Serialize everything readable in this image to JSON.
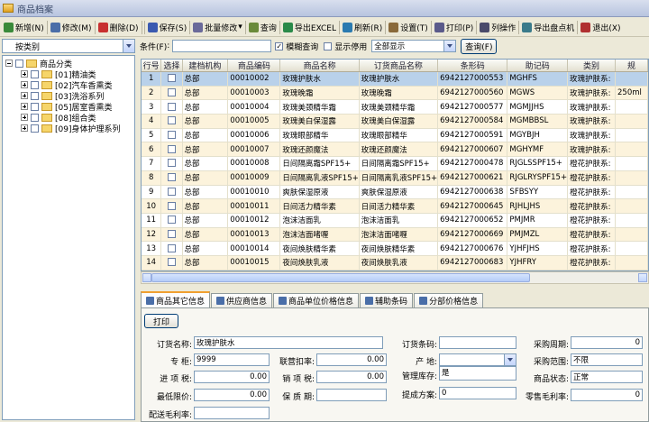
{
  "window": {
    "title": "商品档案"
  },
  "toolbar": [
    {
      "name": "add-button",
      "label": "新增(N)",
      "color": "#3a8a3a"
    },
    {
      "name": "edit-button",
      "label": "修改(M)",
      "color": "#4a6ea8"
    },
    {
      "name": "delete-button",
      "label": "删除(D)",
      "color": "#c83030"
    },
    {
      "name": "sep"
    },
    {
      "name": "save-button",
      "label": "保存(S)",
      "color": "#3a5ab0"
    },
    {
      "name": "batch-edit-button",
      "label": "批量修改",
      "color": "#6a6a9a",
      "dropdown": true
    },
    {
      "name": "query-button",
      "label": "查询",
      "color": "#6a8a3a"
    },
    {
      "name": "export-excel-button",
      "label": "导出EXCEL",
      "color": "#2a8a4a"
    },
    {
      "name": "refresh-button",
      "label": "刷新(R)",
      "color": "#2a7ab0"
    },
    {
      "name": "settings-button",
      "label": "设置(T)",
      "color": "#8a6a3a"
    },
    {
      "name": "print-button",
      "label": "打印(P)",
      "color": "#5a5a8a"
    },
    {
      "name": "columns-button",
      "label": "列操作",
      "color": "#4a4a6a"
    },
    {
      "name": "export-inventory-button",
      "label": "导出盘点机",
      "color": "#3a7a8a"
    },
    {
      "name": "exit-button",
      "label": "退出(X)",
      "color": "#b03030"
    }
  ],
  "left": {
    "combo_value": "按类别",
    "tree_root": "商品分类",
    "tree_items": [
      "[01]精油类",
      "[02]汽车香熏类",
      "[03]洗浴系列",
      "[05]居室香熏类",
      "[08]组合类",
      "[09]身体护理系列"
    ]
  },
  "filter": {
    "condition_label": "条件(F)",
    "condition_value": "",
    "fuzzy_label": "模糊查询",
    "fuzzy_checked": true,
    "show_disabled_label": "显示停用",
    "show_disabled_checked": false,
    "display_value": "全部显示",
    "query_label": "查询(F)"
  },
  "grid": {
    "columns": [
      "行号",
      "选择",
      "建档机构",
      "商品编码",
      "商品名称",
      "订货商品名称",
      "条形码",
      "助记码",
      "类别",
      "规"
    ],
    "rows": [
      [
        "1",
        "",
        "总部",
        "00010002",
        "玫瑰护肤水",
        "玫瑰护肤水",
        "6942127000553",
        "MGHFS",
        "玫瑰护肤系:",
        ""
      ],
      [
        "2",
        "",
        "总部",
        "00010003",
        "玫瑰晚霜",
        "玫瑰晚霜",
        "6942127000560",
        "MGWS",
        "玫瑰护肤系:",
        "250ml"
      ],
      [
        "3",
        "",
        "总部",
        "00010004",
        "玫瑰美颈精华霜",
        "玫瑰美颈精华霜",
        "6942127000577",
        "MGMJJHS",
        "玫瑰护肤系:",
        ""
      ],
      [
        "4",
        "",
        "总部",
        "00010005",
        "玫瑰美白保湿露",
        "玫瑰美白保湿露",
        "6942127000584",
        "MGMBBSL",
        "玫瑰护肤系:",
        ""
      ],
      [
        "5",
        "",
        "总部",
        "00010006",
        "玫瑰眼部精华",
        "玫瑰眼部精华",
        "6942127000591",
        "MGYBJH",
        "玫瑰护肤系:",
        ""
      ],
      [
        "6",
        "",
        "总部",
        "00010007",
        "玫瑰还颜魔法",
        "玫瑰还颜魔法",
        "6942127000607",
        "MGHYMF",
        "玫瑰护肤系:",
        ""
      ],
      [
        "7",
        "",
        "总部",
        "00010008",
        "日间隔离霜SPF15+",
        "日间隔离霜SPF15+",
        "6942127000478",
        "RJGLSSPF15+",
        "橙花护肤系:",
        ""
      ],
      [
        "8",
        "",
        "总部",
        "00010009",
        "日间隔离乳液SPF15+",
        "日间隔离乳液SPF15+",
        "6942127000621",
        "RJGLRYSPF15+",
        "橙花护肤系:",
        ""
      ],
      [
        "9",
        "",
        "总部",
        "00010010",
        "爽肤保湿原液",
        "爽肤保湿原液",
        "6942127000638",
        "SFBSYY",
        "橙花护肤系:",
        ""
      ],
      [
        "10",
        "",
        "总部",
        "00010011",
        "日间活力精华素",
        "日间活力精华素",
        "6942127000645",
        "RJHLJHS",
        "橙花护肤系:",
        ""
      ],
      [
        "11",
        "",
        "总部",
        "00010012",
        "泡沫洁面乳",
        "泡沫洁面乳",
        "6942127000652",
        "PMJMR",
        "橙花护肤系:",
        ""
      ],
      [
        "12",
        "",
        "总部",
        "00010013",
        "泡沫洁面啫喱",
        "泡沫洁面啫喱",
        "6942127000669",
        "PMJMZL",
        "橙花护肤系:",
        ""
      ],
      [
        "13",
        "",
        "总部",
        "00010014",
        "夜间焕肤精华素",
        "夜间焕肤精华素",
        "6942127000676",
        "YJHFJHS",
        "橙花护肤系:",
        ""
      ],
      [
        "14",
        "",
        "总部",
        "00010015",
        "夜间焕肤乳液",
        "夜间焕肤乳液",
        "6942127000683",
        "YJHFRY",
        "橙花护肤系:",
        ""
      ],
      [
        "15",
        "",
        "总部",
        "00010016",
        "夜间焕肤滋润霜",
        "夜间焕肤滋润霜",
        "6942127000690",
        "YJHFZRS",
        "橙花护肤系:",
        ""
      ]
    ],
    "selected_row": 0
  },
  "tabs": [
    "商品其它信息",
    "供应商信息",
    "商品单位价格信息",
    "辅助条码",
    "分部价格信息"
  ],
  "detail": {
    "print_label": "打印",
    "fields": {
      "order_name_label": "订货名称:",
      "order_name_value": "玫瑰护肤水",
      "counter_label": "专    柜:",
      "counter_value": "9999",
      "joint_rate_label": "联营扣率:",
      "joint_rate_value": "0.00",
      "input_tax_label": "进 项 税:",
      "input_tax_value": "0.00",
      "output_tax_label": "销 项 税:",
      "output_tax_value": "0.00",
      "min_price_label": "最低限价:",
      "min_price_value": "0.00",
      "shelf_life_label": "保 质 期:",
      "shelf_life_value": "",
      "dist_margin_label": "配送毛利率:",
      "dist_margin_value": "",
      "order_barcode_label": "订货条码:",
      "order_barcode_value": "",
      "origin_label": "产    地:",
      "origin_value": "",
      "manage_stock_label": "管理库存:",
      "manage_stock_value": "是",
      "proposal_label": "提成方案:",
      "proposal_value": "0",
      "purchase_cycle_label": "采购周期:",
      "purchase_cycle_value": "0",
      "purchase_range_label": "采购范围:",
      "purchase_range_value": "不限",
      "status_label": "商品状态:",
      "status_value": "正常",
      "retail_margin_label": "零售毛利率:",
      "retail_margin_value": "0"
    }
  }
}
